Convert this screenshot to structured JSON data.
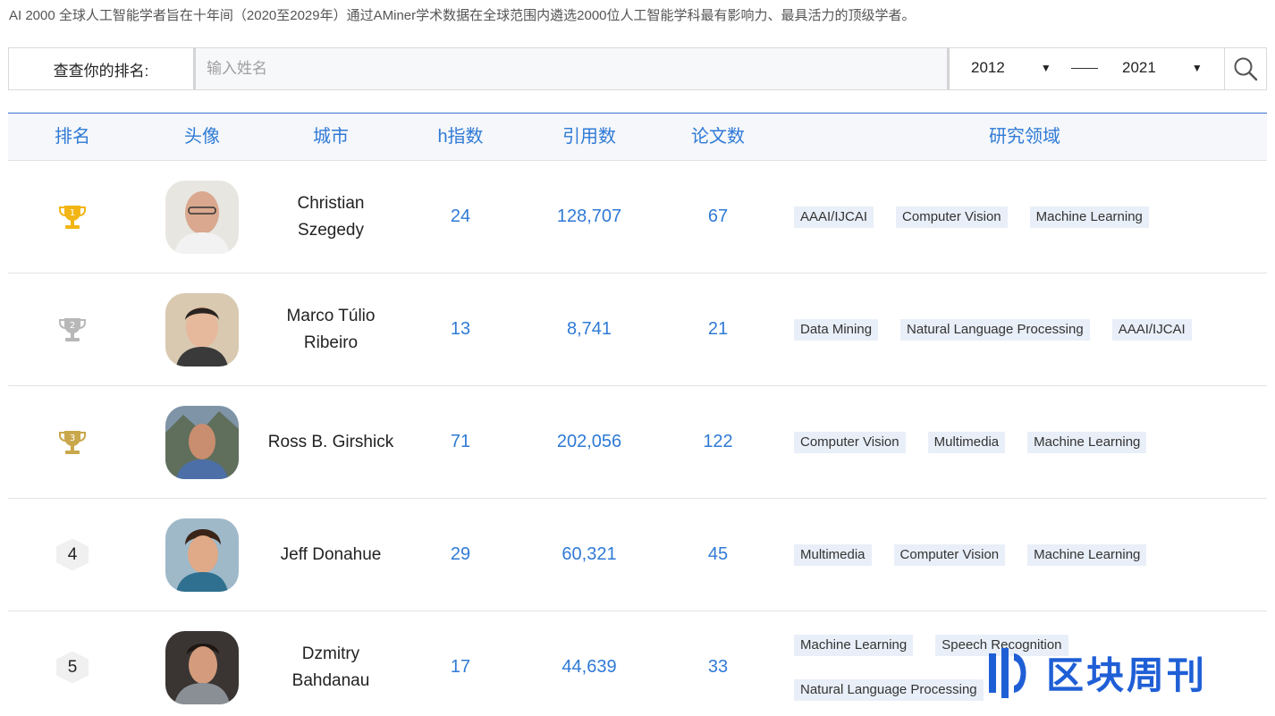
{
  "intro_text": "AI 2000 全球人工智能学者旨在十年间（2020至2029年）通过AMiner学术数据在全球范围内遴选2000位人工智能学科最有影响力、最具活力的顶级学者。",
  "search": {
    "label": "查查你的排名:",
    "placeholder": "输入姓名",
    "year_from": "2012",
    "year_to": "2021",
    "icon": "search-icon"
  },
  "table": {
    "headers": [
      "排名",
      "头像",
      "城市",
      "h指数",
      "引用数",
      "论文数",
      "研究领域"
    ],
    "rows": [
      {
        "rank": "1",
        "rank_icon": "gold-trophy-icon",
        "name_line1": "Christian",
        "name_line2": "Szegedy",
        "h_index": "24",
        "citations": "128,707",
        "papers": "67",
        "tags": [
          "AAAI/IJCAI",
          "Computer Vision",
          "Machine Learning"
        ]
      },
      {
        "rank": "2",
        "rank_icon": "silver-trophy-icon",
        "name_line1": "Marco Túlio",
        "name_line2": "Ribeiro",
        "h_index": "13",
        "citations": "8,741",
        "papers": "21",
        "tags": [
          "Data Mining",
          "Natural Language Processing",
          "AAAI/IJCAI"
        ]
      },
      {
        "rank": "3",
        "rank_icon": "bronze-trophy-icon",
        "name_line1": "Ross B. Girshick",
        "name_line2": "",
        "h_index": "71",
        "citations": "202,056",
        "papers": "122",
        "tags": [
          "Computer Vision",
          "Multimedia",
          "Machine Learning"
        ]
      },
      {
        "rank": "4",
        "rank_icon": "",
        "name_line1": "Jeff Donahue",
        "name_line2": "",
        "h_index": "29",
        "citations": "60,321",
        "papers": "45",
        "tags": [
          "Multimedia",
          "Computer Vision",
          "Machine Learning"
        ]
      },
      {
        "rank": "5",
        "rank_icon": "",
        "name_line1": "Dzmitry",
        "name_line2": "Bahdanau",
        "h_index": "17",
        "citations": "44,639",
        "papers": "33",
        "tags": [
          "Machine Learning",
          "Speech Recognition",
          "Natural Language Processing"
        ]
      }
    ]
  },
  "watermark": "区块周刊",
  "colors": {
    "accent": "#2f7ad6",
    "header_border": "#3b6fd1",
    "tag_bg": "#e9eff8",
    "gold": "#f2b515",
    "silver": "#b8b8b8",
    "bronze": "#c9a74a"
  }
}
